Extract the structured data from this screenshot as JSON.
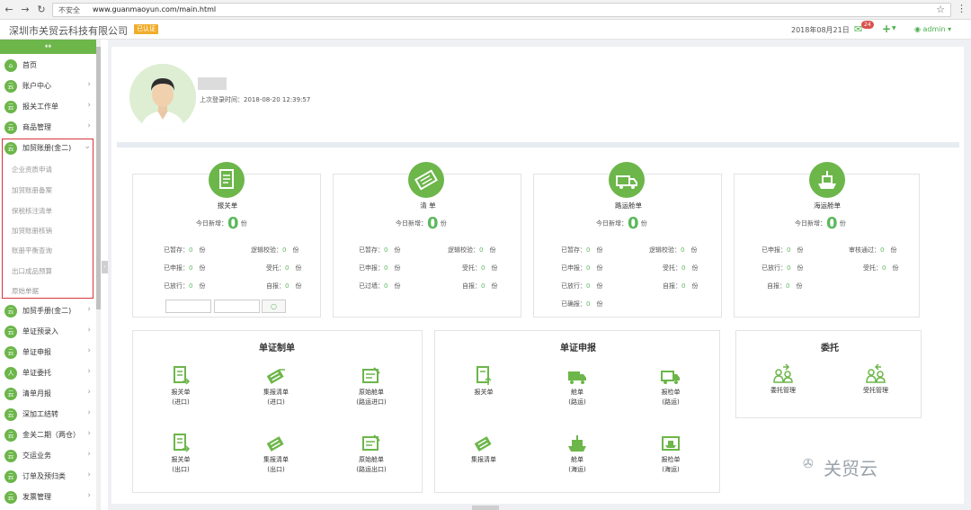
{
  "browser": {
    "security": "不安全",
    "url": "www.guanmaoyun.com/main.html"
  },
  "topbar": {
    "company": "深圳市关贸云科技有限公司",
    "cert": "已认证",
    "date": "2018年08月21日",
    "bell_count": "24",
    "plus": "+",
    "user": "admin"
  },
  "sidebar": {
    "toggle": "↔",
    "items": [
      {
        "label": "首页",
        "icon": "home-icon"
      },
      {
        "label": "账户中心",
        "icon": "cloud-icon"
      },
      {
        "label": "报关工作单",
        "icon": "cloud-icon"
      },
      {
        "label": "商品管理",
        "icon": "cloud-icon"
      },
      {
        "label": "加贸账册(金二)",
        "icon": "cloud-icon",
        "expanded": true
      },
      {
        "label": "加贸手册(金二)",
        "icon": "cloud-icon"
      },
      {
        "label": "单证预录入",
        "icon": "cloud-icon"
      },
      {
        "label": "单证申报",
        "icon": "cloud-icon"
      },
      {
        "label": "单证委托",
        "icon": "user-icon"
      },
      {
        "label": "清单月报",
        "icon": "cloud-icon"
      },
      {
        "label": "深加工结转",
        "icon": "cloud-icon"
      },
      {
        "label": "金关二期（两仓）",
        "icon": "cloud-icon"
      },
      {
        "label": "交运业务",
        "icon": "cloud-icon"
      },
      {
        "label": "订单及预归类",
        "icon": "cloud-icon"
      },
      {
        "label": "发票管理",
        "icon": "cloud-icon"
      }
    ],
    "subitems": [
      "企业资质申请",
      "加贸账册备案",
      "保税核注清单",
      "加贸账册核销",
      "账册平衡查询",
      "出口成品预算",
      "原始单据"
    ]
  },
  "profile": {
    "last_login_label": "上次登录时间：2018-08-20 12:39:57"
  },
  "cards": [
    {
      "title": "报关单",
      "today_label": "今日新增：",
      "today": "0",
      "unit": "份",
      "stats": [
        [
          "已暂存：",
          "0",
          "份"
        ],
        [
          "逻辑校验：",
          "0",
          "份"
        ],
        [
          "已申报：",
          "0",
          "份"
        ],
        [
          "受托：",
          "0",
          "份"
        ],
        [
          "已放行：",
          "0",
          "份"
        ],
        [
          "自报：",
          "0",
          "份"
        ]
      ],
      "button": "○"
    },
    {
      "title": "清 单",
      "today_label": "今日新增：",
      "today": "0",
      "unit": "份",
      "stats": [
        [
          "已暂存：",
          "0",
          "份"
        ],
        [
          "逻辑校验：",
          "0",
          "份"
        ],
        [
          "已申报：",
          "0",
          "份"
        ],
        [
          "受托：",
          "0",
          "份"
        ],
        [
          "已过墙：",
          "0",
          "份"
        ],
        [
          "自报：",
          "0",
          "份"
        ]
      ]
    },
    {
      "title": "路运舱单",
      "today_label": "今日新增：",
      "today": "0",
      "unit": "份",
      "stats": [
        [
          "已暂存：",
          "0",
          "份"
        ],
        [
          "逻辑校验：",
          "0",
          "份"
        ],
        [
          "已申报：",
          "0",
          "份"
        ],
        [
          "受托：",
          "0",
          "份"
        ],
        [
          "已放行：",
          "0",
          "份"
        ],
        [
          "自报：",
          "0",
          "份"
        ],
        [
          "已确报：",
          "0",
          "份"
        ]
      ]
    },
    {
      "title": "海运舱单",
      "today_label": "今日新增：",
      "today": "0",
      "unit": "份",
      "stats": [
        [
          "已申报：",
          "0",
          "份"
        ],
        [
          "审核通过：",
          "0",
          "份"
        ],
        [
          "已放行：",
          "0",
          "份"
        ],
        [
          "受托：",
          "0",
          "份"
        ],
        [
          "自报：",
          "0",
          "份"
        ]
      ]
    }
  ],
  "sections": {
    "make": {
      "title": "单证制单",
      "tools": [
        [
          "报关单",
          "(进口)"
        ],
        [
          "集报清单",
          "(进口)"
        ],
        [
          "原始舱单",
          "(路运进口)"
        ],
        [
          "报关单",
          "(出口)"
        ],
        [
          "集报清单",
          "(出口)"
        ],
        [
          "原始舱单",
          "(路运出口)"
        ]
      ]
    },
    "declare": {
      "title": "单证申报",
      "tools": [
        [
          "报关单",
          ""
        ],
        [
          "舱单",
          "(路运)"
        ],
        [
          "报检单",
          "(路运)"
        ],
        [
          "集报清单",
          ""
        ],
        [
          "舱单",
          "(海运)"
        ],
        [
          "报检单",
          "(海运)"
        ]
      ]
    },
    "entrust": {
      "title": "委托",
      "tools": [
        [
          "委托管理",
          ""
        ],
        [
          "受托管理",
          ""
        ]
      ]
    }
  },
  "watermark": "关贸云"
}
